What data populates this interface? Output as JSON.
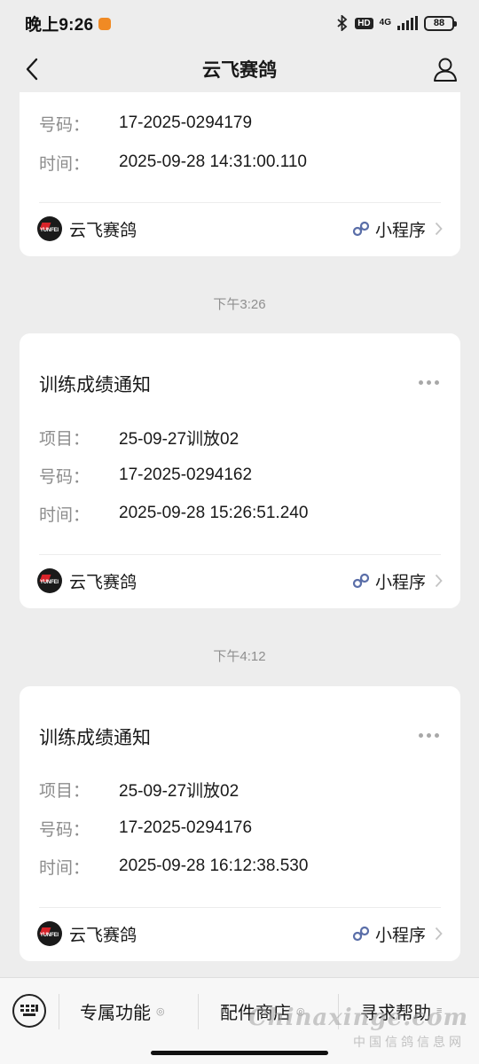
{
  "status_bar": {
    "time": "晚上9:26",
    "hd": "HD",
    "network": "4G",
    "battery": "88"
  },
  "header": {
    "title": "云飞赛鸽"
  },
  "cards": [
    {
      "title": "",
      "rows": [
        {
          "label": "号码：",
          "value": "17-2025-0294179"
        },
        {
          "label": "时间：",
          "value": "2025-09-28 14:31:00.110"
        }
      ],
      "source": "云飞赛鸽",
      "link": "小程序"
    },
    {
      "timestamp": "下午3:26",
      "title": "训练成绩通知",
      "rows": [
        {
          "label": "项目：",
          "value": "25-09-27训放02"
        },
        {
          "label": "号码：",
          "value": "17-2025-0294162"
        },
        {
          "label": "时间：",
          "value": "2025-09-28 15:26:51.240"
        }
      ],
      "source": "云飞赛鸽",
      "link": "小程序"
    },
    {
      "timestamp": "下午4:12",
      "title": "训练成绩通知",
      "rows": [
        {
          "label": "项目：",
          "value": "25-09-27训放02"
        },
        {
          "label": "号码：",
          "value": "17-2025-0294176"
        },
        {
          "label": "时间：",
          "value": "2025-09-28 16:12:38.530"
        }
      ],
      "source": "云飞赛鸽",
      "link": "小程序"
    }
  ],
  "logo_text": "YUNFEI",
  "bottom_menu": {
    "items": [
      "专属功能",
      "配件商店",
      "寻求帮助"
    ]
  },
  "watermark": {
    "site": "Chinaxinge.com",
    "cn": "中国信鸽信息网"
  },
  "colors": {
    "background": "#ededed",
    "card": "#ffffff",
    "link_icon": "#5a6ea8",
    "logo_red": "#d8232a"
  }
}
